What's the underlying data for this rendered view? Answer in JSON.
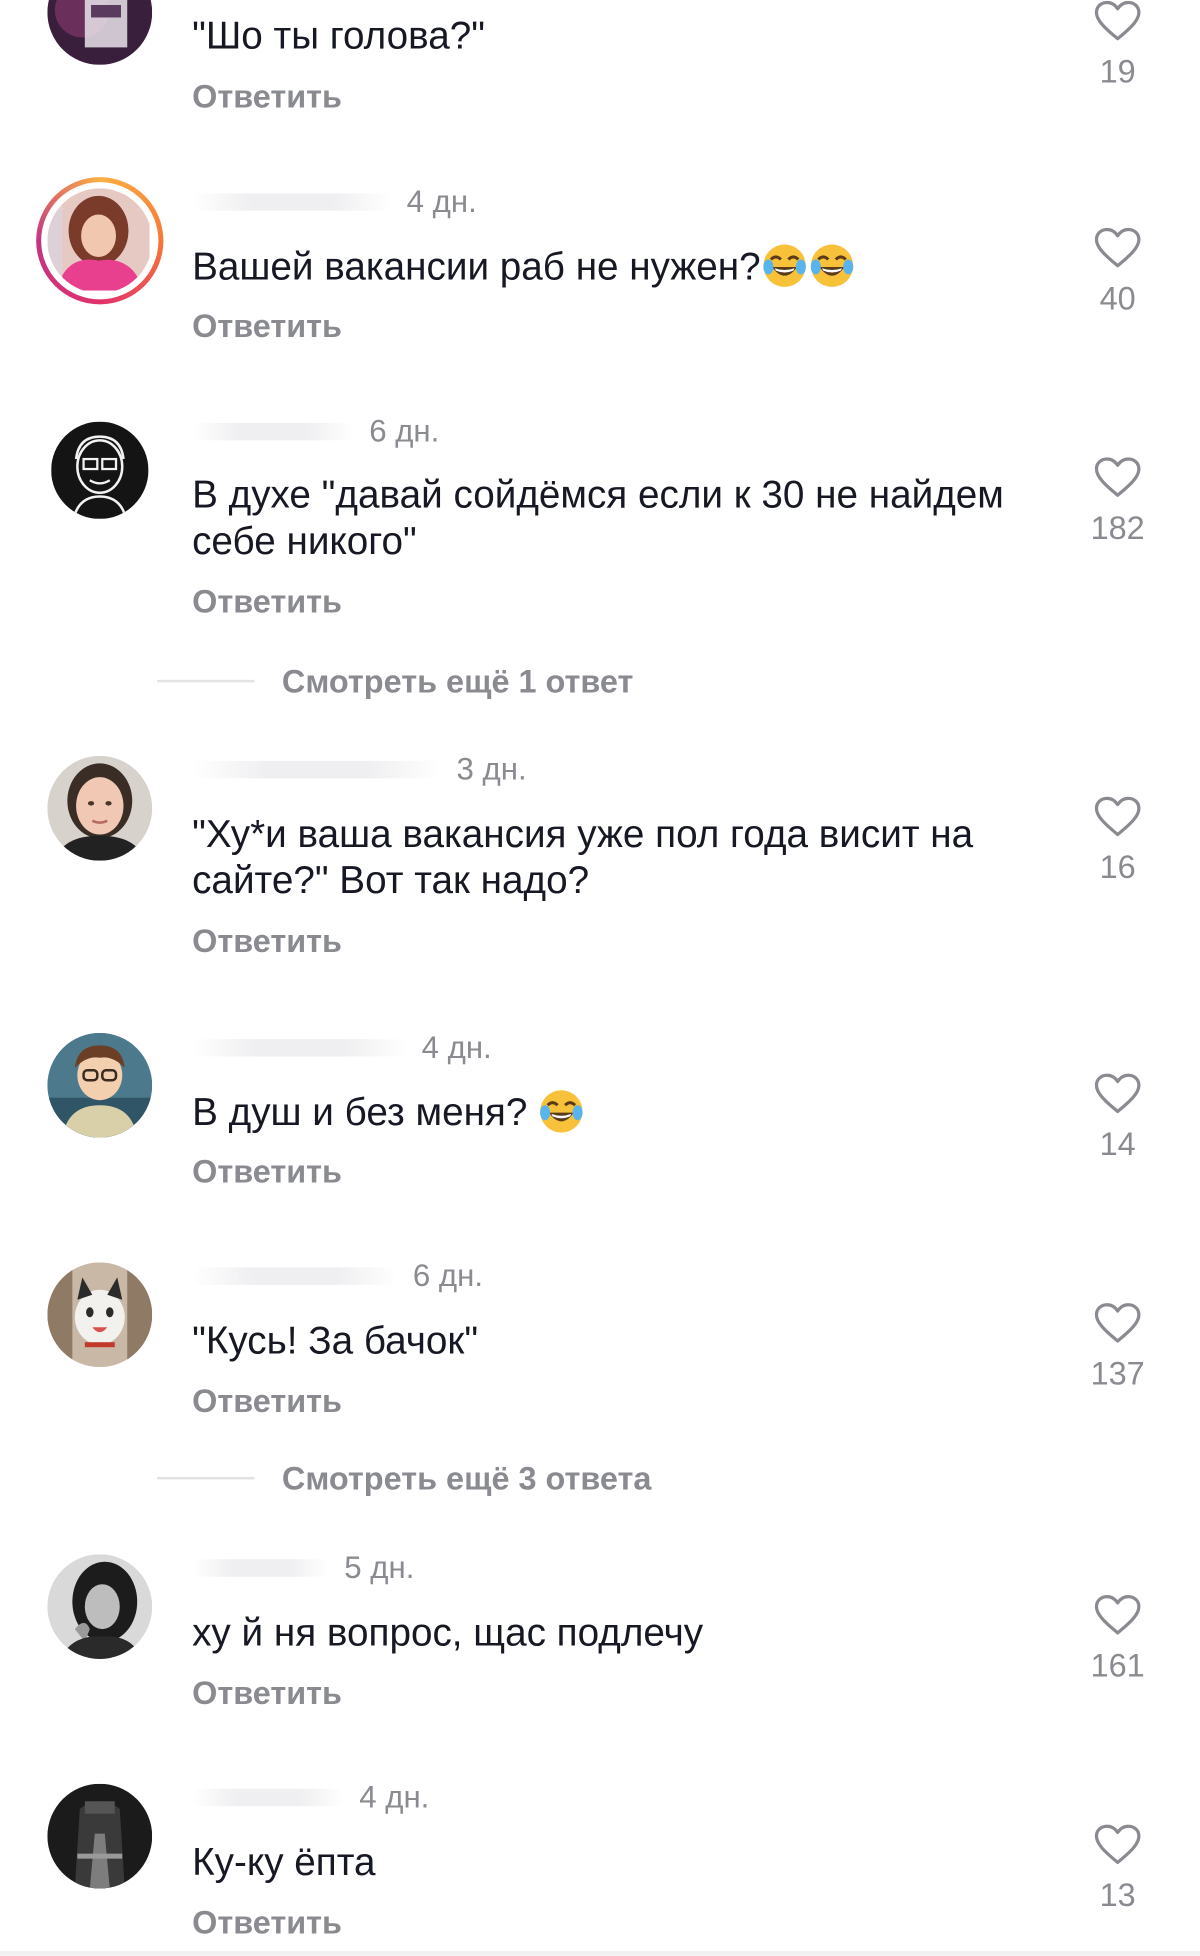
{
  "comments": [
    {
      "time": "",
      "text": "\"Шо ты голова?\"",
      "reply_label": "Ответить",
      "likes": "19",
      "avatar": "avatar-dark-purple"
    },
    {
      "time": "4 дн.",
      "text": "Вашей вакансии раб не нужен?",
      "reply_label": "Ответить",
      "likes": "40",
      "avatar": "avatar-pink-girl-story-ring"
    },
    {
      "time": "6 дн.",
      "text": "В духе \"давай сойдёмся если к 30 не найдем себе никого\"",
      "reply_label": "Ответить",
      "likes": "182",
      "avatar": "avatar-sketch-face"
    },
    {
      "time": "3 дн.",
      "text": "\"Ху*и ваша вакансия уже пол года висит на сайте?\" Вот так надо?",
      "reply_label": "Ответить",
      "likes": "16",
      "avatar": "avatar-woman-selfie"
    },
    {
      "time": "4 дн.",
      "text": "В душ и без  меня?",
      "reply_label": "Ответить",
      "likes": "14",
      "avatar": "avatar-cartoon-boy"
    },
    {
      "time": "6 дн.",
      "text": "\"Кусь! За бачок\"",
      "reply_label": "Ответить",
      "likes": "137",
      "avatar": "avatar-cat"
    },
    {
      "time": "5 дн.",
      "text": "ху й ня  вопрос, щас подлечу",
      "reply_label": "Ответить",
      "likes": "161",
      "avatar": "avatar-bw-girl"
    },
    {
      "time": "4 дн.",
      "text": "Ку-ку ёпта",
      "reply_label": "Ответить",
      "likes": "13",
      "avatar": "avatar-dark-figure"
    }
  ],
  "more_replies": [
    {
      "label": "Смотреть ещё 1 ответ"
    },
    {
      "label": "Смотреть ещё 3 ответа"
    }
  ],
  "icons": {
    "like": "heart-outline-icon",
    "emoji": "face-with-tears-of-joy"
  },
  "colors": {
    "text": "#161823",
    "secondary": "#8a8b91",
    "divider": "#e3e3e6"
  }
}
